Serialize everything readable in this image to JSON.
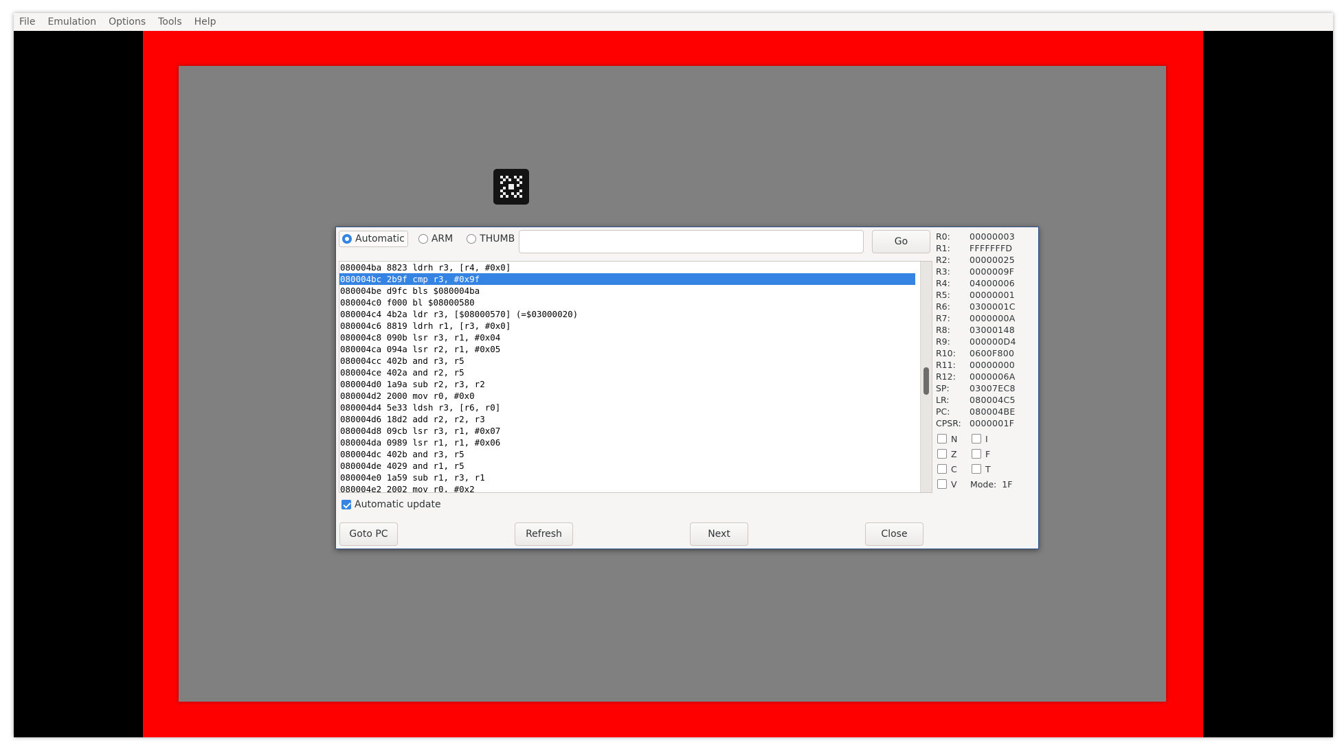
{
  "menubar": {
    "items": [
      "File",
      "Emulation",
      "Options",
      "Tools",
      "Help"
    ]
  },
  "dialog": {
    "modes": [
      {
        "label": "Automatic",
        "selected": true
      },
      {
        "label": "ARM",
        "selected": false
      },
      {
        "label": "THUMB",
        "selected": false
      }
    ],
    "address": {
      "value": "",
      "placeholder": ""
    },
    "go_label": "Go",
    "disassembly": [
      "080004ba 8823 ldrh r3, [r4, #0x0]",
      "080004bc 2b9f cmp r3, #0x9f",
      "080004be d9fc bls $080004ba",
      "080004c0 f000 bl $08000580",
      "080004c4 4b2a ldr r3, [$08000570] (=$03000020)",
      "080004c6 8819 ldrh r1, [r3, #0x0]",
      "080004c8 090b lsr r3, r1, #0x04",
      "080004ca 094a lsr r2, r1, #0x05",
      "080004cc 402b and r3, r5",
      "080004ce 402a and r2, r5",
      "080004d0 1a9a sub r2, r3, r2",
      "080004d2 2000 mov r0, #0x0",
      "080004d4 5e33 ldsh r3, [r6, r0]",
      "080004d6 18d2 add r2, r2, r3",
      "080004d8 09cb lsr r3, r1, #0x07",
      "080004da 0989 lsr r1, r1, #0x06",
      "080004dc 402b and r3, r5",
      "080004de 4029 and r1, r5",
      "080004e0 1a59 sub r1, r3, r1",
      "080004e2 2002 mov r0, #0x2"
    ],
    "selected_line": 1,
    "registers": [
      {
        "name": "R0:",
        "value": "00000003"
      },
      {
        "name": "R1:",
        "value": "FFFFFFFD"
      },
      {
        "name": "R2:",
        "value": "00000025"
      },
      {
        "name": "R3:",
        "value": "0000009F"
      },
      {
        "name": "R4:",
        "value": "04000006"
      },
      {
        "name": "R5:",
        "value": "00000001"
      },
      {
        "name": "R6:",
        "value": "0300001C"
      },
      {
        "name": "R7:",
        "value": "0000000A"
      },
      {
        "name": "R8:",
        "value": "03000148"
      },
      {
        "name": "R9:",
        "value": "000000D4"
      },
      {
        "name": "R10:",
        "value": "0600F800"
      },
      {
        "name": "R11:",
        "value": "00000000"
      },
      {
        "name": "R12:",
        "value": "0000006A"
      },
      {
        "name": "SP:",
        "value": "03007EC8"
      },
      {
        "name": "LR:",
        "value": "080004C5"
      },
      {
        "name": "PC:",
        "value": "080004BE"
      },
      {
        "name": "CPSR:",
        "value": "0000001F"
      }
    ],
    "flags": {
      "N": "N",
      "Z": "Z",
      "C": "C",
      "V": "V",
      "I": "I",
      "F": "F",
      "T": "T"
    },
    "mode_label": "Mode:",
    "mode_value": "1F",
    "auto_update_label": "Automatic update",
    "auto_update_checked": true,
    "buttons": {
      "goto_pc": "Goto PC",
      "refresh": "Refresh",
      "next": "Next",
      "close": "Close"
    }
  },
  "colors": {
    "frame_red": "#ff0000",
    "screen_gray": "#808080",
    "selection_blue": "#3584e4"
  }
}
